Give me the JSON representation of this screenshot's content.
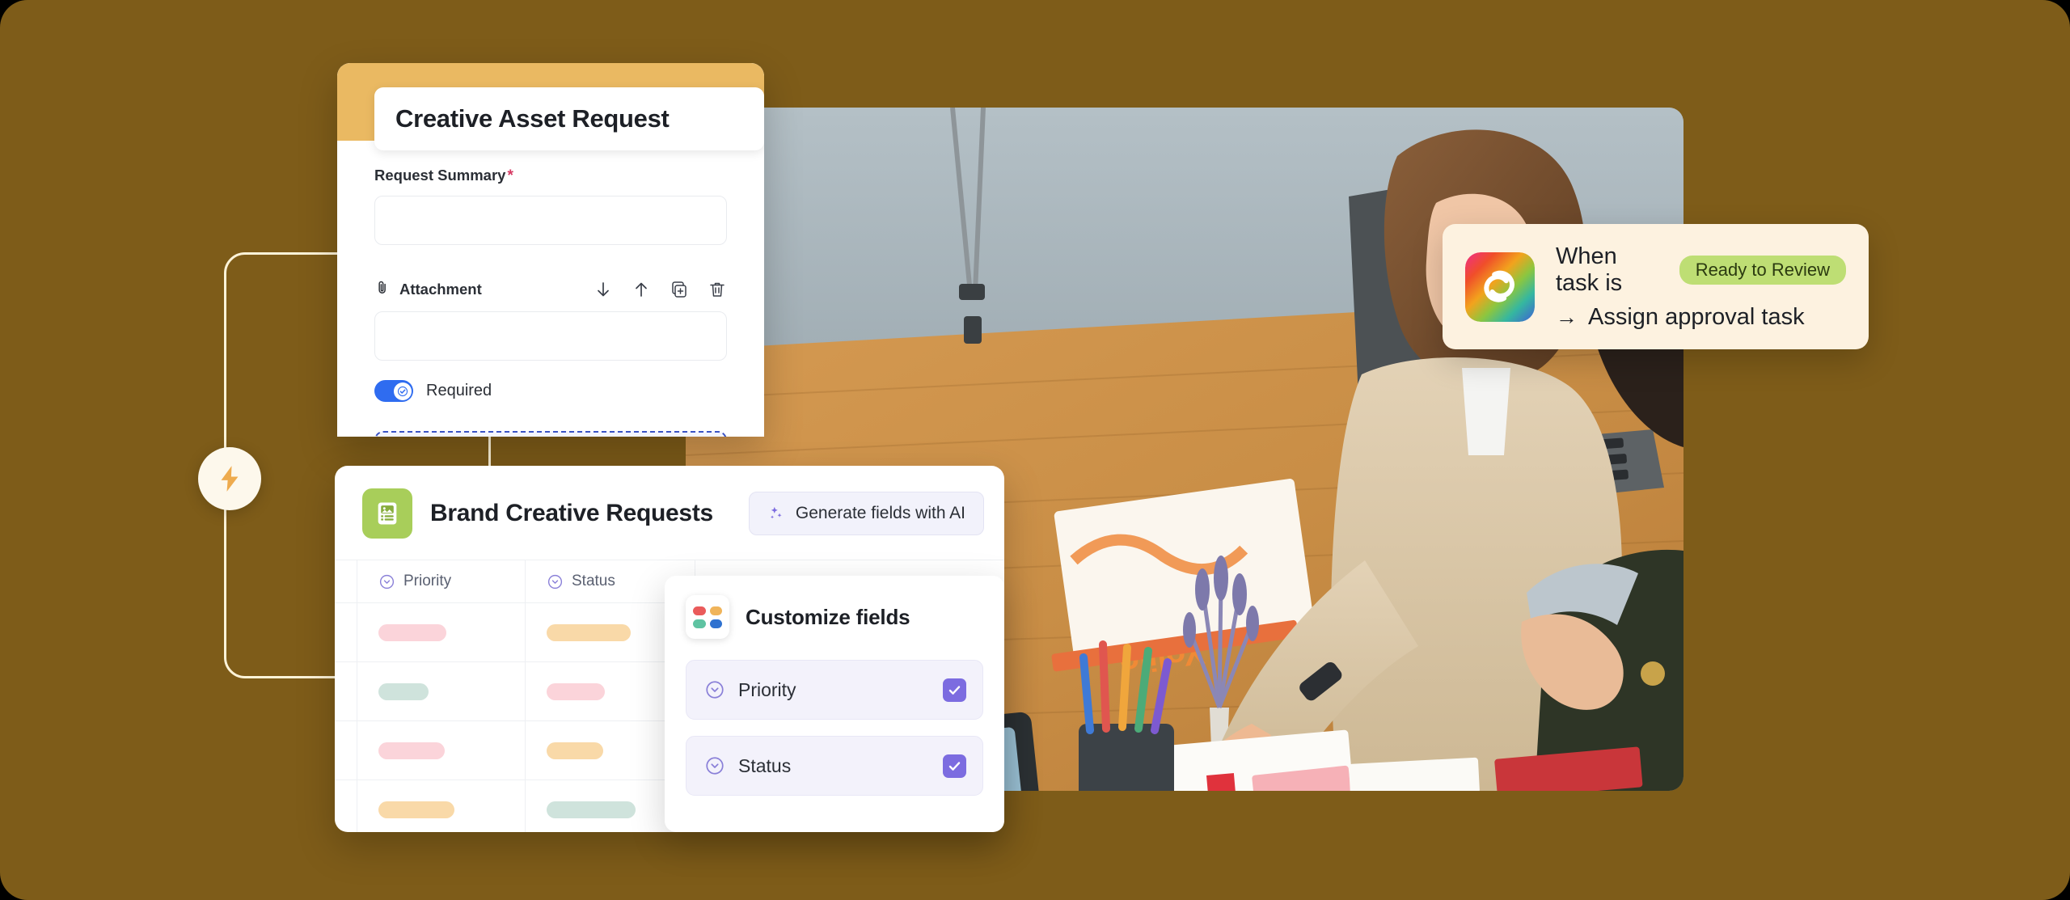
{
  "theme": {
    "background": "#7e5c19",
    "accent_orange": "#eab962",
    "accent_cream": "#fdf3d8",
    "brand_green": "#a8ce5a",
    "purple": "#7c6ce0",
    "toggle_blue": "#2f6cf0",
    "pill_green": "#bede74",
    "automation_card_bg": "#fdf2e0"
  },
  "form_builder": {
    "title": "Creative Asset Request",
    "summary_field": {
      "label": "Request Summary",
      "required_marker": "*",
      "value": "",
      "placeholder": ""
    },
    "attachment_field": {
      "label": "Attachment",
      "icon": "paperclip-icon",
      "value": "",
      "actions": [
        "move-down-icon",
        "move-up-icon",
        "duplicate-icon",
        "delete-icon"
      ]
    },
    "required_toggle": {
      "label": "Required",
      "state": "on"
    },
    "drop_zone": {
      "label": ""
    }
  },
  "brand_panel": {
    "icon": "image-list-icon",
    "title": "Brand Creative Requests",
    "ai_button": {
      "label": "Generate fields with AI",
      "icon": "sparkles-icon"
    },
    "table": {
      "columns": [
        {
          "label": "Priority",
          "icon": "chevron-circle-icon"
        },
        {
          "label": "Status",
          "icon": "chevron-circle-icon"
        }
      ],
      "rows": [
        {
          "priority_color": "#fbd4da",
          "priority_width": 84,
          "status_color": "#f9d9a8",
          "status_width": 104
        },
        {
          "priority_color": "#cfe3dc",
          "priority_width": 62,
          "status_color": "#fbd4da",
          "status_width": 72
        },
        {
          "priority_color": "#fbd4da",
          "priority_width": 82,
          "status_color": "#f9d9a8",
          "status_width": 70
        },
        {
          "priority_color": "#f9d9a8",
          "priority_width": 94,
          "status_color": "#cfe3dc",
          "status_width": 110
        }
      ]
    }
  },
  "customize_fields": {
    "icon": "color-pills-icon",
    "title": "Customize fields",
    "icon_colors": [
      "#ea5b5b",
      "#f0b45a",
      "#5fc3a2",
      "#2f72d0"
    ],
    "items": [
      {
        "label": "Priority",
        "icon": "chevron-circle-icon",
        "checked": true
      },
      {
        "label": "Status",
        "icon": "chevron-circle-icon",
        "checked": true
      }
    ]
  },
  "automation_card": {
    "app_icon": "adobe-creative-cloud-icon",
    "trigger_prefix": "When task is",
    "trigger_status": "Ready to Review",
    "action_arrow": "→",
    "action_label": "Assign approval task"
  },
  "decor": {
    "bolt_icon": "lightning-bolt-icon"
  }
}
